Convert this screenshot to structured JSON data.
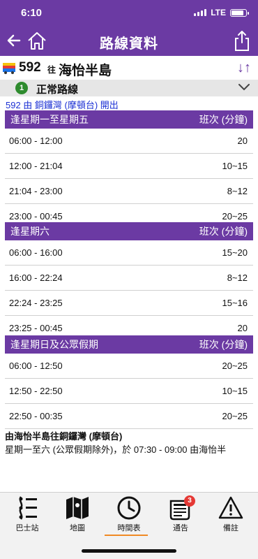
{
  "status": {
    "time": "6:10",
    "carrier": "LTE"
  },
  "nav": {
    "title": "路線資料"
  },
  "route": {
    "number": "592",
    "direction": "往",
    "destination": "海怡半島"
  },
  "section": {
    "number": "1",
    "label": "正常路線"
  },
  "departure": "592 由 銅鑼灣 (摩頓台) 開出",
  "timetables": [
    {
      "day": "逢星期一至星期五",
      "freq_header": "班次 (分鐘)",
      "rows": [
        {
          "time": "06:00 - 12:00",
          "freq": "20"
        },
        {
          "time": "12:00 - 21:04",
          "freq": "10~15"
        },
        {
          "time": "21:04 - 23:00",
          "freq": "8~12"
        },
        {
          "time": "23:00 - 00:45",
          "freq": "20~25"
        }
      ]
    },
    {
      "day": "逢星期六",
      "freq_header": "班次 (分鐘)",
      "rows": [
        {
          "time": "06:00 - 16:00",
          "freq": "15~20"
        },
        {
          "time": "16:00 - 22:24",
          "freq": "8~12"
        },
        {
          "time": "22:24 - 23:25",
          "freq": "15~16"
        },
        {
          "time": "23:25 - 00:45",
          "freq": "20"
        }
      ]
    },
    {
      "day": "逢星期日及公眾假期",
      "freq_header": "班次 (分鐘)",
      "rows": [
        {
          "time": "06:00 - 12:50",
          "freq": "20~25"
        },
        {
          "time": "12:50 - 22:50",
          "freq": "10~15"
        },
        {
          "time": "22:50 - 00:35",
          "freq": "20~25"
        }
      ]
    }
  ],
  "note": {
    "title": "由海怡半島往銅鑼灣 (摩頓台)",
    "text": "星期一至六 (公眾假期除外)，於 07:30 - 09:00 由海怡半"
  },
  "tabs": [
    {
      "label": "巴士站",
      "icon": "bus-stop-icon"
    },
    {
      "label": "地圖",
      "icon": "map-icon"
    },
    {
      "label": "時間表",
      "icon": "clock-icon"
    },
    {
      "label": "通告",
      "icon": "notice-icon",
      "badge": "3"
    },
    {
      "label": "備註",
      "icon": "warning-icon"
    }
  ],
  "colors": {
    "primary": "#6b3aa3",
    "active": "#f08a24",
    "badge": "#e53935",
    "section_badge": "#2e8b2e",
    "link": "#1a2fd4"
  }
}
